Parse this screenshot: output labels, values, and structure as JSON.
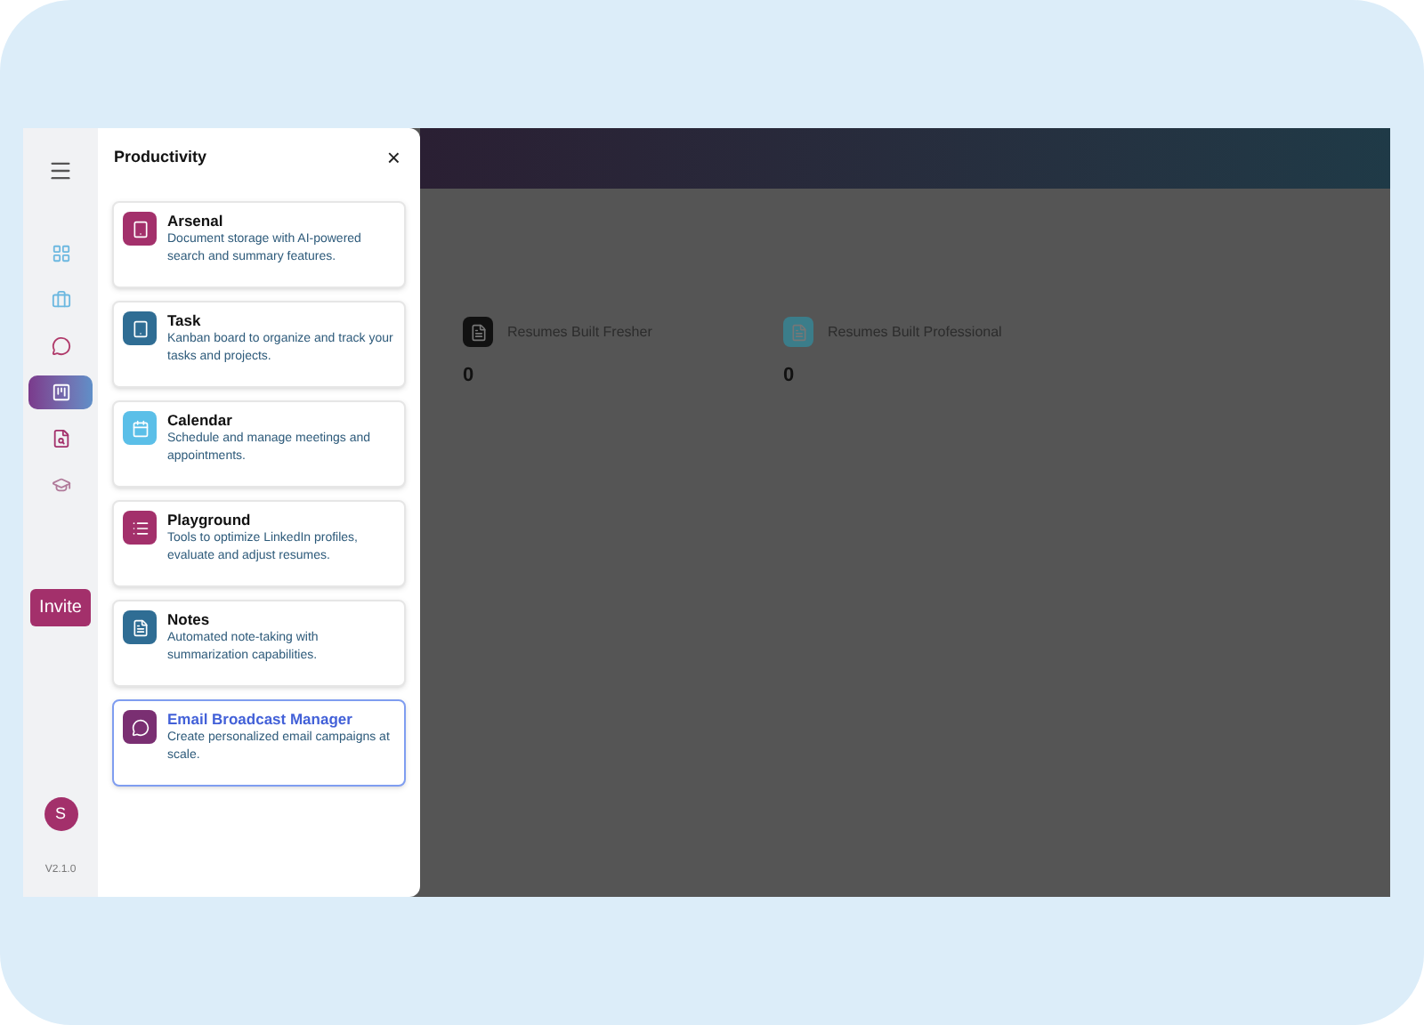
{
  "sidebar": {
    "nav": [
      {
        "kind": "grid",
        "selected": false
      },
      {
        "kind": "briefcase",
        "selected": false
      },
      {
        "kind": "chat",
        "selected": false
      },
      {
        "kind": "board",
        "selected": true
      },
      {
        "kind": "search-doc",
        "selected": false
      },
      {
        "kind": "cap",
        "selected": false
      }
    ],
    "invite": "Invite",
    "avatar": "S",
    "version": "V2.1.0"
  },
  "panel": {
    "title": "Productivity",
    "close": "×",
    "items": [
      {
        "kind": "book",
        "color": "#a3306b",
        "title": "Arsenal",
        "description": "Document storage with AI-powered search and summary features.",
        "selected": false
      },
      {
        "kind": "book",
        "color": "#2f6d94",
        "title": "Task",
        "description": "Kanban board to organize and track your tasks and projects.",
        "selected": false
      },
      {
        "kind": "calendar",
        "color": "#5bbfe8",
        "title": "Calendar",
        "description": "Schedule and manage meetings and appointments.",
        "selected": false
      },
      {
        "kind": "list",
        "color": "#a3306b",
        "title": "Playground",
        "description": "Tools to optimize LinkedIn profiles, evaluate and adjust resumes.",
        "selected": false
      },
      {
        "kind": "note",
        "color": "#2f6d94",
        "title": "Notes",
        "description": "Automated note-taking with summarization capabilities.",
        "selected": false
      },
      {
        "kind": "chat",
        "color": "#7a2f72",
        "title": "Email Broadcast Manager",
        "description": "Create personalized email campaigns at scale.",
        "selected": true
      }
    ]
  },
  "stats": [
    {
      "label": "Resumes Built Fresher",
      "value": "0",
      "color": "#111111"
    },
    {
      "label": "Resumes Built Professional",
      "value": "0",
      "color": "#3b7d8a"
    }
  ]
}
